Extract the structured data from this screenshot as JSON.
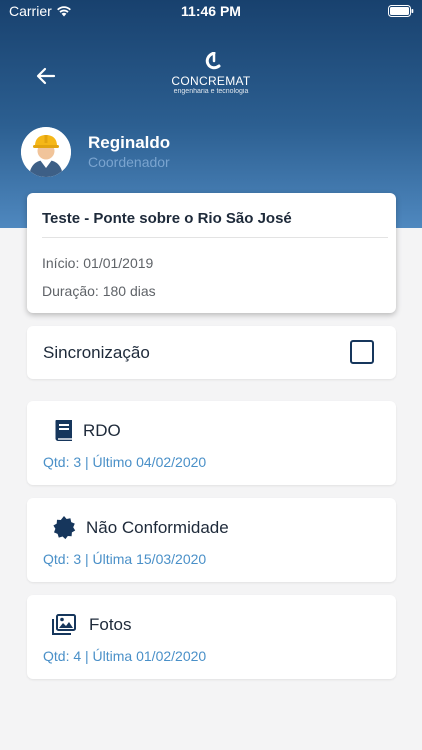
{
  "status_bar": {
    "carrier": "Carrier",
    "time": "11:46 PM",
    "wifi_icon": "wifi-icon",
    "battery_icon": "battery-icon"
  },
  "header": {
    "back_icon": "arrow-left-icon",
    "logo": {
      "name": "CONCREMAT",
      "tagline": "engenharia e tecnologia"
    }
  },
  "user": {
    "name": "Reginaldo",
    "role": "Coordenador",
    "avatar_icon": "worker-avatar"
  },
  "project": {
    "title": "Teste - Ponte sobre o Rio São José",
    "start": "Início: 01/01/2019",
    "duration": "Duração: 180 dias"
  },
  "sync": {
    "label": "Sincronização",
    "checked": false
  },
  "modules": [
    {
      "title": "RDO",
      "info": "Qtd: 3 | Último 04/02/2020",
      "icon": "book-icon"
    },
    {
      "title": "Não Conformidade",
      "info": "Qtd: 3 | Última 15/03/2020",
      "icon": "badge-icon"
    },
    {
      "title": "Fotos",
      "info": "Qtd: 4 | Última 01/02/2020",
      "icon": "photos-icon"
    }
  ],
  "colors": {
    "header_dark": "#18416e",
    "header_light": "#4f88bf",
    "accent": "#4a90c8",
    "text": "#1e2a3a"
  }
}
